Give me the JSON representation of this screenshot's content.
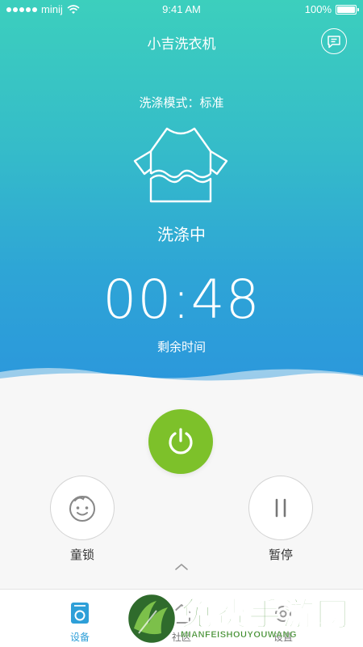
{
  "status_bar": {
    "carrier": "minij",
    "time": "9:41 AM",
    "battery": "100%"
  },
  "header": {
    "title": "小吉洗衣机"
  },
  "washer": {
    "mode_label": "洗涤模式：标准",
    "state": "洗涤中",
    "timer": "00:48",
    "timer_caption": "剩余时间"
  },
  "controls": {
    "child_lock_label": "童锁",
    "pause_label": "暂停"
  },
  "tabbar": {
    "tabs": [
      {
        "label": "设备",
        "active": true
      },
      {
        "label": "社区",
        "active": false
      },
      {
        "label": "设置",
        "active": false
      }
    ]
  },
  "watermark": {
    "title": "免费手游网",
    "subtitle": "MIANFEISHOUYOUWANG"
  },
  "colors": {
    "accent": "#2e9fd8",
    "power": "#7dc12a",
    "gradient_top": "#3ccfbd",
    "gradient_bottom": "#2b97dc"
  }
}
